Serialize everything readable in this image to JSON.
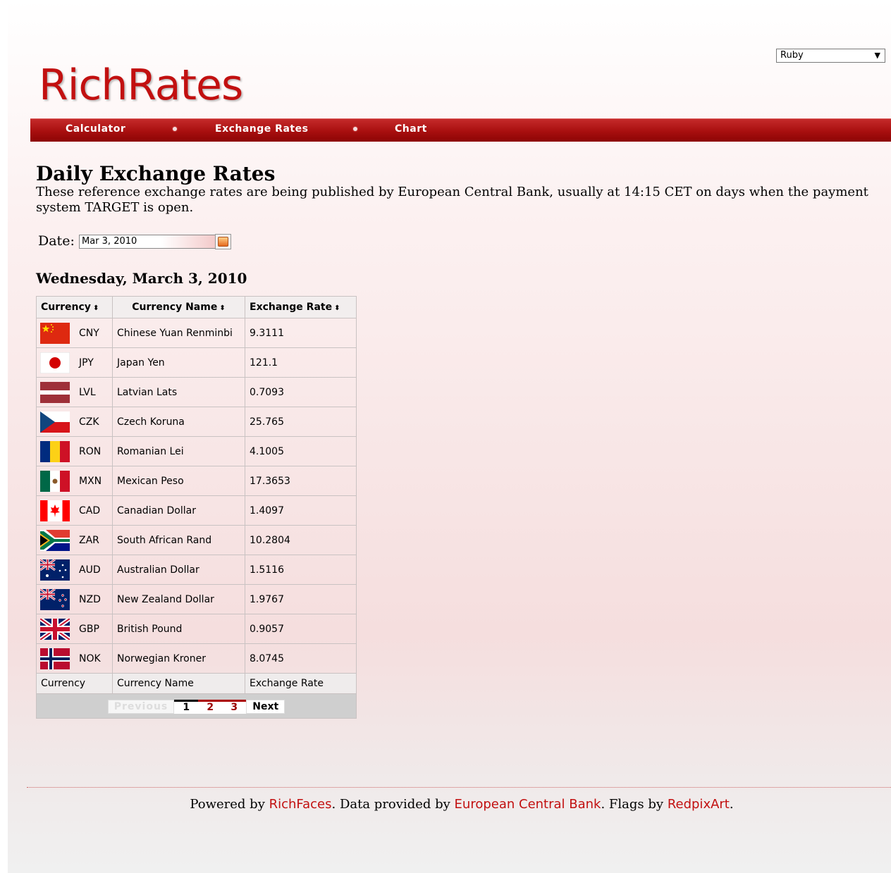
{
  "skin_selector": {
    "value": "Ruby"
  },
  "app": {
    "logo_text": "RichRates"
  },
  "nav": {
    "items": [
      {
        "label": "Calculator"
      },
      {
        "label": "Exchange Rates"
      },
      {
        "label": "Chart"
      }
    ]
  },
  "main": {
    "title": "Daily Exchange Rates",
    "description": "These reference exchange rates are being published by European Central Bank, usually at 14:15 CET on days when the payment system TARGET is open.",
    "date_label": "Date:",
    "date_value": "Mar 3, 2010",
    "date_heading": "Wednesday, March 3, 2010"
  },
  "table": {
    "headers": {
      "currency": "Currency",
      "currency_name": "Currency Name",
      "exchange_rate": "Exchange Rate"
    },
    "rows": [
      {
        "code": "CNY",
        "name": "Chinese Yuan Renminbi",
        "rate": "9.3111"
      },
      {
        "code": "JPY",
        "name": "Japan Yen",
        "rate": "121.1"
      },
      {
        "code": "LVL",
        "name": "Latvian Lats",
        "rate": "0.7093"
      },
      {
        "code": "CZK",
        "name": "Czech Koruna",
        "rate": "25.765"
      },
      {
        "code": "RON",
        "name": "Romanian Lei",
        "rate": "4.1005"
      },
      {
        "code": "MXN",
        "name": "Mexican Peso",
        "rate": "17.3653"
      },
      {
        "code": "CAD",
        "name": "Canadian Dollar",
        "rate": "1.4097"
      },
      {
        "code": "ZAR",
        "name": "South African Rand",
        "rate": "10.2804"
      },
      {
        "code": "AUD",
        "name": "Australian Dollar",
        "rate": "1.5116"
      },
      {
        "code": "NZD",
        "name": "New Zealand Dollar",
        "rate": "1.9767"
      },
      {
        "code": "GBP",
        "name": "British Pound",
        "rate": "0.9057"
      },
      {
        "code": "NOK",
        "name": "Norwegian Kroner",
        "rate": "8.0745"
      }
    ],
    "footers": {
      "currency": "Currency",
      "currency_name": "Currency Name",
      "exchange_rate": "Exchange Rate"
    },
    "pager": {
      "previous": "Previous",
      "pages": [
        "1",
        "2",
        "3"
      ],
      "current_page": "1",
      "next": "Next"
    }
  },
  "footer": {
    "powered_by": "Powered by",
    "richfaces_link": "RichFaces",
    "data_text": ". Data provided by",
    "ecb_link": "European Central Bank",
    "flags_text": ". Flags by",
    "redpix_link": "RedpixArt",
    "end_text": "."
  },
  "colors": {
    "brand_red": "#c21010",
    "nav_red": "#a80f0f"
  }
}
